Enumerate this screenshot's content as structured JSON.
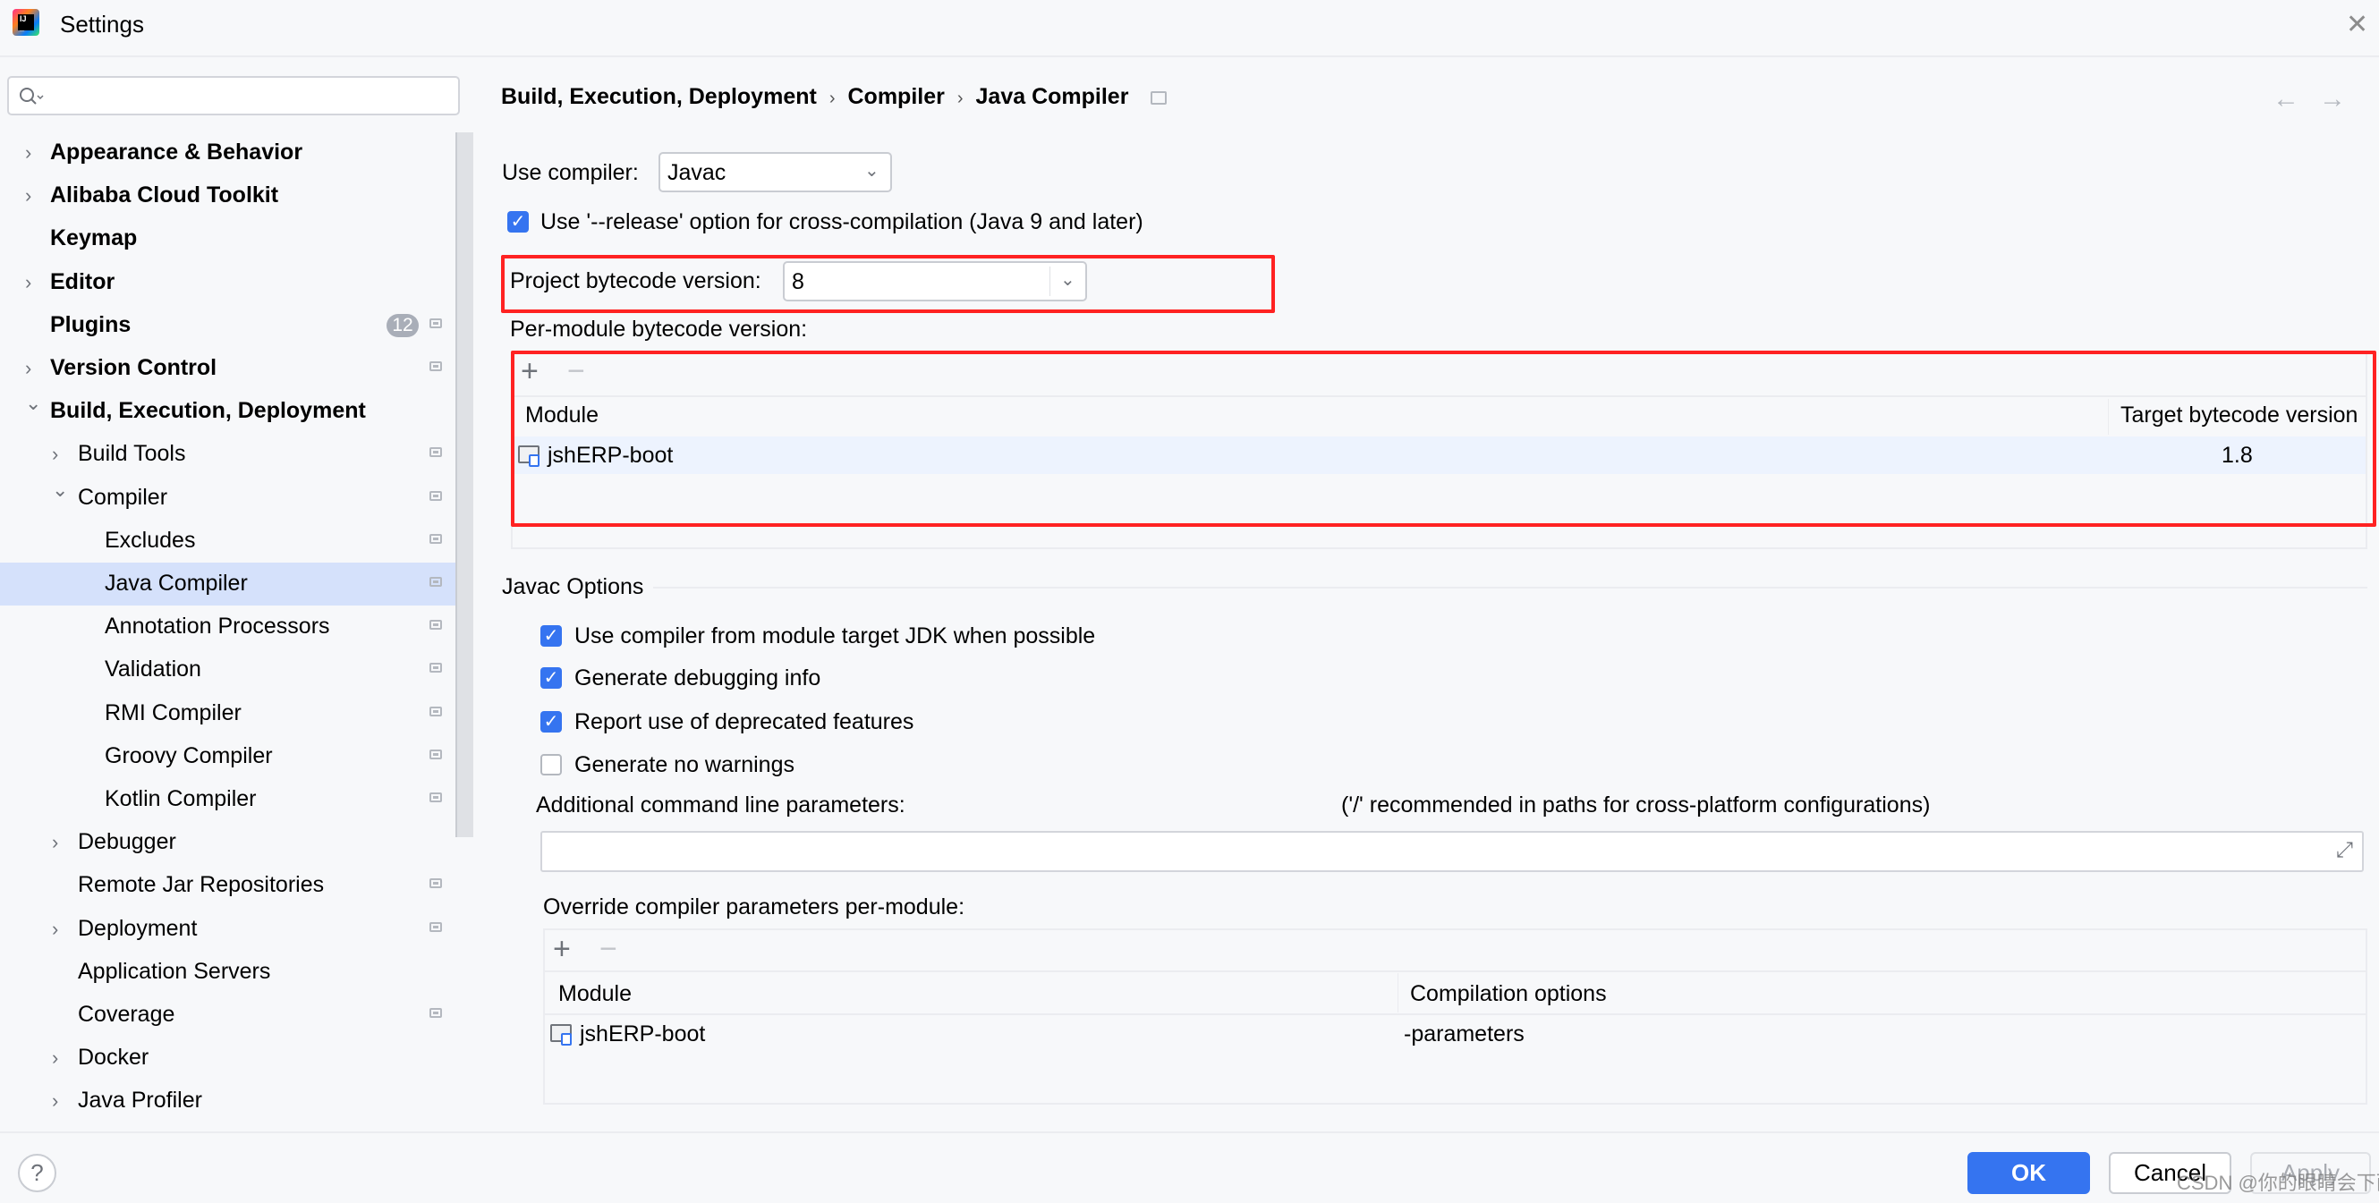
{
  "window": {
    "title": "Settings",
    "app_icon": "intellij-idea-icon",
    "close_icon": "close-icon"
  },
  "search": {
    "placeholder": "",
    "value": "",
    "icon": "search-icon"
  },
  "sidebar": {
    "items": [
      {
        "label": "Appearance & Behavior",
        "level": 0,
        "expandable": true,
        "expanded": false,
        "bold": true,
        "config_icon": false
      },
      {
        "label": "Alibaba Cloud Toolkit",
        "level": 0,
        "expandable": true,
        "expanded": false,
        "bold": true,
        "config_icon": false
      },
      {
        "label": "Keymap",
        "level": 0,
        "expandable": false,
        "bold": true,
        "config_icon": false
      },
      {
        "label": "Editor",
        "level": 0,
        "expandable": true,
        "expanded": false,
        "bold": true,
        "config_icon": false
      },
      {
        "label": "Plugins",
        "level": 0,
        "expandable": false,
        "bold": true,
        "config_icon": true,
        "badge": "12"
      },
      {
        "label": "Version Control",
        "level": 0,
        "expandable": true,
        "expanded": false,
        "bold": true,
        "config_icon": true
      },
      {
        "label": "Build, Execution, Deployment",
        "level": 0,
        "expandable": true,
        "expanded": true,
        "bold": true,
        "config_icon": false
      },
      {
        "label": "Build Tools",
        "level": 1,
        "expandable": true,
        "expanded": false,
        "config_icon": true
      },
      {
        "label": "Compiler",
        "level": 1,
        "expandable": true,
        "expanded": true,
        "config_icon": true
      },
      {
        "label": "Excludes",
        "level": 2,
        "expandable": false,
        "config_icon": true
      },
      {
        "label": "Java Compiler",
        "level": 2,
        "expandable": false,
        "config_icon": true,
        "selected": true
      },
      {
        "label": "Annotation Processors",
        "level": 2,
        "expandable": false,
        "config_icon": true
      },
      {
        "label": "Validation",
        "level": 2,
        "expandable": false,
        "config_icon": true
      },
      {
        "label": "RMI Compiler",
        "level": 2,
        "expandable": false,
        "config_icon": true
      },
      {
        "label": "Groovy Compiler",
        "level": 2,
        "expandable": false,
        "config_icon": true
      },
      {
        "label": "Kotlin Compiler",
        "level": 2,
        "expandable": false,
        "config_icon": true
      },
      {
        "label": "Debugger",
        "level": 1,
        "expandable": true,
        "expanded": false,
        "config_icon": false
      },
      {
        "label": "Remote Jar Repositories",
        "level": 1,
        "expandable": false,
        "config_icon": true
      },
      {
        "label": "Deployment",
        "level": 1,
        "expandable": true,
        "expanded": false,
        "config_icon": true
      },
      {
        "label": "Application Servers",
        "level": 1,
        "expandable": false,
        "config_icon": false
      },
      {
        "label": "Coverage",
        "level": 1,
        "expandable": false,
        "config_icon": true
      },
      {
        "label": "Docker",
        "level": 1,
        "expandable": true,
        "expanded": false,
        "config_icon": false
      },
      {
        "label": "Java Profiler",
        "level": 1,
        "expandable": true,
        "expanded": false,
        "config_icon": false
      }
    ]
  },
  "breadcrumb": {
    "items": [
      "Build, Execution, Deployment",
      "Compiler",
      "Java Compiler"
    ],
    "separator": "›"
  },
  "nav": {
    "back": "←",
    "forward": "→"
  },
  "main": {
    "use_compiler": {
      "label": "Use compiler:",
      "value": "Javac"
    },
    "release_option": {
      "label": "Use '--release' option for cross-compilation (Java 9 and later)",
      "checked": true
    },
    "project_bytecode": {
      "label": "Project bytecode version:",
      "value": "8"
    },
    "per_module": {
      "label": "Per-module bytecode version:",
      "add": "+",
      "remove": "−",
      "columns": [
        "Module",
        "Target bytecode version"
      ],
      "rows": [
        {
          "module": "jshERP-boot",
          "target": "1.8"
        }
      ]
    },
    "javac_options": {
      "title": "Javac Options",
      "checkboxes": [
        {
          "label": "Use compiler from module target JDK when possible",
          "checked": true
        },
        {
          "label": "Generate debugging info",
          "checked": true
        },
        {
          "label": "Report use of deprecated features",
          "checked": true
        },
        {
          "label": "Generate no warnings",
          "checked": false
        }
      ],
      "additional_params": {
        "label": "Additional command line parameters:",
        "hint": "('/' recommended in paths for cross-platform configurations)",
        "value": ""
      },
      "override": {
        "label": "Override compiler parameters per-module:",
        "add": "+",
        "remove": "−",
        "columns": [
          "Module",
          "Compilation options"
        ],
        "rows": [
          {
            "module": "jshERP-boot",
            "options": "-parameters"
          }
        ]
      }
    }
  },
  "footer": {
    "help": "?",
    "ok": "OK",
    "cancel": "Cancel",
    "apply": "Apply",
    "watermark": "CSDN @你的眼睛会下雨"
  },
  "colors": {
    "accent": "#3574f0",
    "selection": "#d5e1fb",
    "annotation_red": "#ff2222",
    "background": "#f7f8fa"
  }
}
